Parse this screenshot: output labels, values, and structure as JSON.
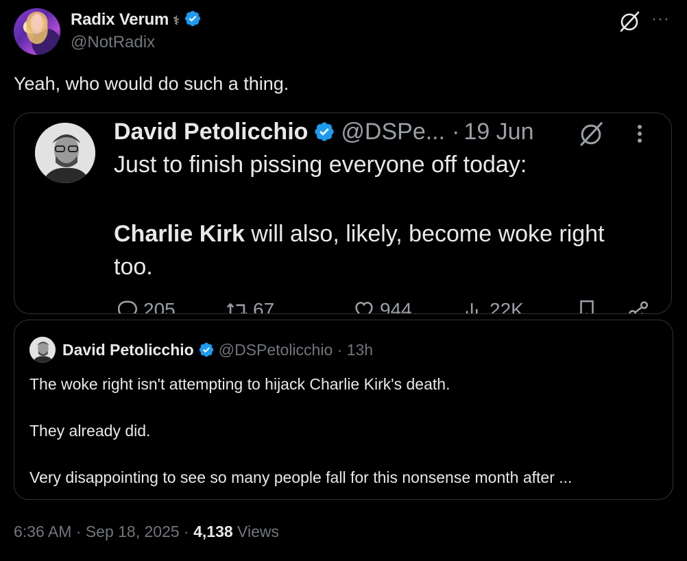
{
  "author": {
    "name": "Radix Verum",
    "name_glyph": "⚕",
    "handle": "@NotRadix"
  },
  "tweet": {
    "text": "Yeah, who would do such a thing."
  },
  "quoted_screenshot": {
    "name": "David Petolicchio",
    "handle": "@DSPe...",
    "separator": "·",
    "date": "19 Jun",
    "line1": "Just to finish pissing everyone off today:",
    "mention": "Charlie Kirk",
    "line2_rest": " will also, likely, become woke right too.",
    "actions": {
      "replies": "205",
      "reposts": "67",
      "likes": "944",
      "views": "22K"
    }
  },
  "quoted_tweet": {
    "name": "David Petolicchio",
    "handle": "@DSPetolicchio",
    "time": "· 13h",
    "para1": "The woke right isn't attempting to hijack Charlie Kirk's death.",
    "para2": "They already did.",
    "para3": "Very disappointing to see so many people fall for this nonsense month after ..."
  },
  "footer": {
    "time": "6:36 AM · Sep 18, 2025 · ",
    "views_count": "4,138",
    "views_label": " Views"
  },
  "colors": {
    "background": "#000000",
    "text": "#e7e9ea",
    "muted": "#71767b",
    "verified": "#1d9bf0",
    "border": "#2f3336"
  },
  "icons": [
    "grok-icon",
    "more-icon",
    "verified-badge-icon",
    "reply-icon",
    "repost-icon",
    "like-icon",
    "views-icon",
    "bookmark-icon",
    "share-icon"
  ]
}
